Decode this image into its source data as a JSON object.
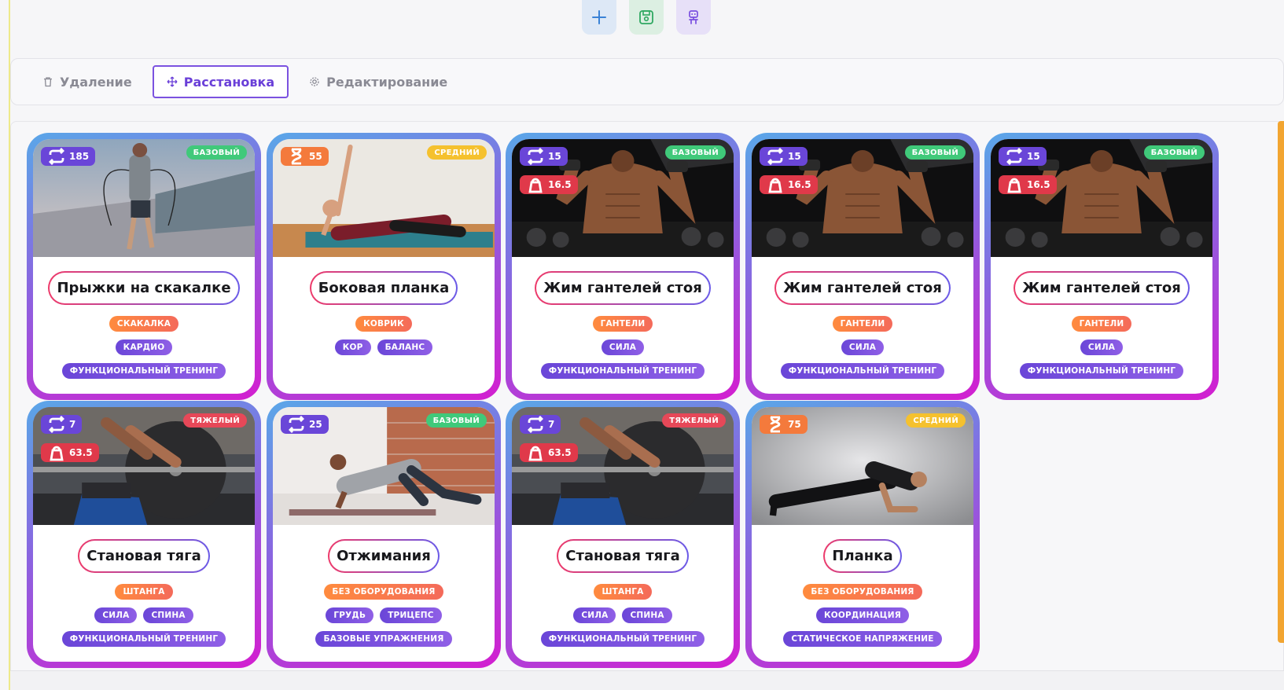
{
  "toolbar": {
    "add_icon": "plus-icon",
    "save_icon": "floppy-icon",
    "bot_icon": "robot-icon"
  },
  "modes": [
    {
      "label": "Удаление",
      "icon": "trash-icon",
      "active": false
    },
    {
      "label": "Расстановка",
      "icon": "move-icon",
      "active": true
    },
    {
      "label": "Редактирование",
      "icon": "gear-icon",
      "active": false
    }
  ],
  "cards": [
    {
      "title": "Прыжки на скакалке",
      "count": "185",
      "count_type": "repeat",
      "weight": null,
      "level": "БАЗОВЫЙ",
      "level_kind": "base",
      "photo": "jump-rope",
      "equipment": [
        "СКАКАЛКА"
      ],
      "muscles": [
        "КАРДИО"
      ],
      "category": [
        "ФУНКЦИОНАЛЬНЫЙ ТРЕНИНГ"
      ]
    },
    {
      "title": "Боковая планка",
      "count": "55",
      "count_type": "timer",
      "weight": null,
      "level": "СРЕДНИЙ",
      "level_kind": "mid",
      "photo": "side-plank",
      "equipment": [
        "КОВРИК"
      ],
      "muscles": [
        "КОР",
        "БАЛАНС"
      ],
      "category": []
    },
    {
      "title": "Жим гантелей стоя",
      "count": "15",
      "count_type": "repeat",
      "weight": "16.5",
      "level": "БАЗОВЫЙ",
      "level_kind": "base",
      "photo": "dumbbell",
      "equipment": [
        "ГАНТЕЛИ"
      ],
      "muscles": [
        "СИЛА"
      ],
      "category": [
        "ФУНКЦИОНАЛЬНЫЙ ТРЕНИНГ"
      ]
    },
    {
      "title": "Жим гантелей стоя",
      "count": "15",
      "count_type": "repeat",
      "weight": "16.5",
      "level": "БАЗОВЫЙ",
      "level_kind": "base",
      "photo": "dumbbell",
      "equipment": [
        "ГАНТЕЛИ"
      ],
      "muscles": [
        "СИЛА"
      ],
      "category": [
        "ФУНКЦИОНАЛЬНЫЙ ТРЕНИНГ"
      ]
    },
    {
      "title": "Жим гантелей стоя",
      "count": "15",
      "count_type": "repeat",
      "weight": "16.5",
      "level": "БАЗОВЫЙ",
      "level_kind": "base",
      "photo": "dumbbell",
      "equipment": [
        "ГАНТЕЛИ"
      ],
      "muscles": [
        "СИЛА"
      ],
      "category": [
        "ФУНКЦИОНАЛЬНЫЙ ТРЕНИНГ"
      ]
    },
    {
      "title": "Становая тяга",
      "count": "7",
      "count_type": "repeat",
      "weight": "63.5",
      "level": "ТЯЖЕЛЫЙ",
      "level_kind": "hard",
      "photo": "deadlift",
      "equipment": [
        "ШТАНГА"
      ],
      "muscles": [
        "СИЛА",
        "СПИНА"
      ],
      "category": [
        "ФУНКЦИОНАЛЬНЫЙ ТРЕНИНГ"
      ]
    },
    {
      "title": "Отжимания",
      "count": "25",
      "count_type": "repeat",
      "weight": null,
      "level": "БАЗОВЫЙ",
      "level_kind": "base",
      "photo": "pushup",
      "equipment": [
        "БЕЗ ОБОРУДОВАНИЯ"
      ],
      "muscles": [
        "ГРУДЬ",
        "ТРИЦЕПС"
      ],
      "category": [
        "БАЗОВЫЕ УПРАЖНЕНИЯ"
      ]
    },
    {
      "title": "Становая тяга",
      "count": "7",
      "count_type": "repeat",
      "weight": "63.5",
      "level": "ТЯЖЕЛЫЙ",
      "level_kind": "hard",
      "photo": "deadlift",
      "equipment": [
        "ШТАНГА"
      ],
      "muscles": [
        "СИЛА",
        "СПИНА"
      ],
      "category": [
        "ФУНКЦИОНАЛЬНЫЙ ТРЕНИНГ"
      ]
    },
    {
      "title": "Планка",
      "count": "75",
      "count_type": "timer",
      "weight": null,
      "level": "СРЕДНИЙ",
      "level_kind": "mid",
      "photo": "plank",
      "equipment": [
        "БЕЗ ОБОРУДОВАНИЯ"
      ],
      "muscles": [
        "КООРДИНАЦИЯ"
      ],
      "category": [
        "СТАТИЧЕСКОЕ НАПРЯЖЕНИЕ"
      ]
    }
  ],
  "colors": {
    "repeat_badge": "#6a46d8",
    "timer_badge": "#f47a3c",
    "weight_badge": "#e0394a",
    "accent": "#7b52e0"
  }
}
